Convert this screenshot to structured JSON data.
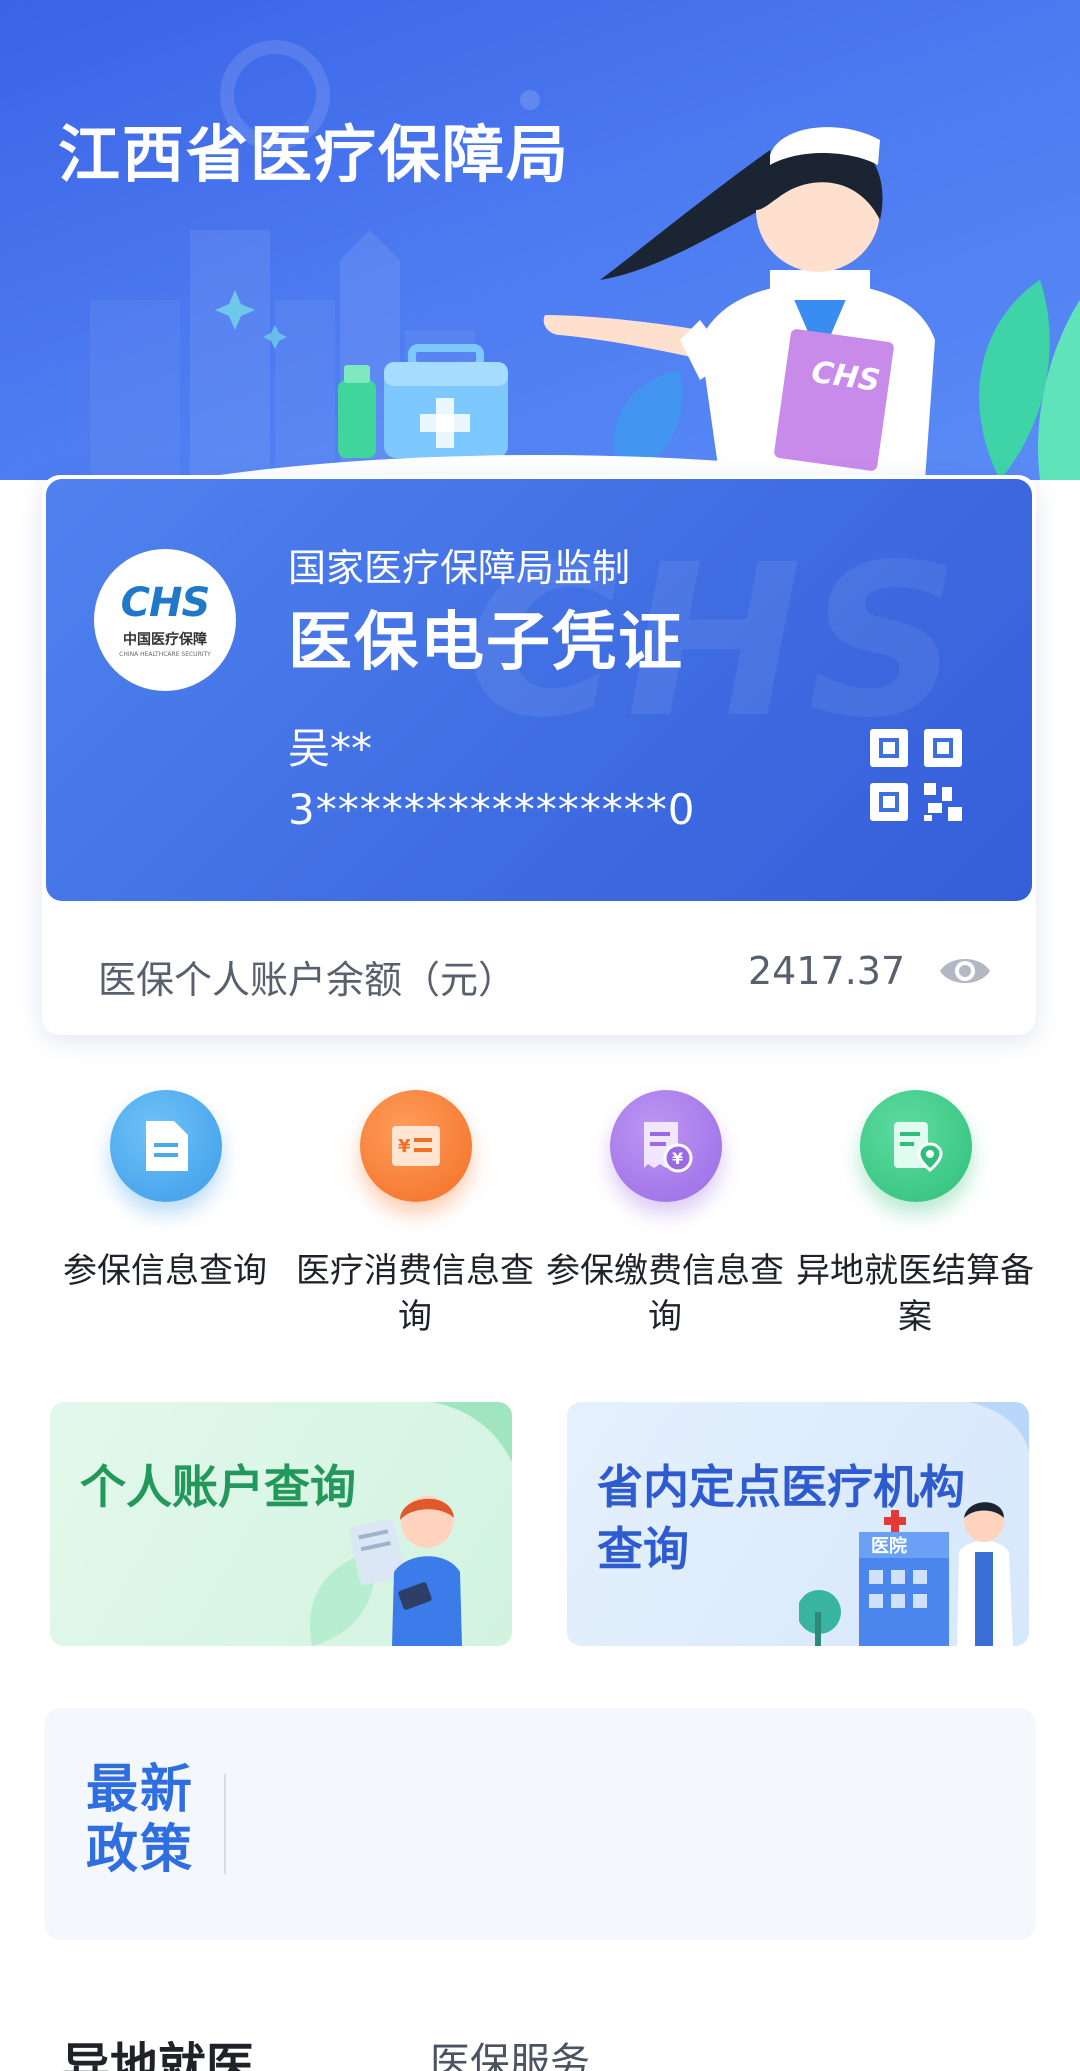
{
  "header": {
    "title": "江西省医疗保障局"
  },
  "card": {
    "logo_mark": "CHS",
    "logo_text": "中国医疗保障",
    "logo_subtext": "CHINA HEALTHCARE SECURITY",
    "supervisor": "国家医疗保障局监制",
    "title": "医保电子凭证",
    "holder_name": "吴**",
    "holder_id": "3****************0",
    "badge_text": "CHS",
    "balance_label": "医保个人账户余额（元）",
    "balance_value": "2417.37"
  },
  "services": [
    {
      "label": "参保信息查询",
      "icon": "document-icon",
      "color": "#4aa8ee"
    },
    {
      "label": "医疗消费信息查询",
      "icon": "receipt-icon",
      "color": "#f4843c"
    },
    {
      "label": "参保缴费信息查询",
      "icon": "payment-record-icon",
      "color": "#a77be9"
    },
    {
      "label": "异地就医结算备案",
      "icon": "location-doc-icon",
      "color": "#37c384"
    }
  ],
  "tiles": {
    "personal_account": "个人账户查询",
    "institution_line1": "省内定点医疗机构",
    "institution_line2": "查询",
    "hospital_sign": "医院"
  },
  "news": {
    "line1": "最新",
    "line2": "政策"
  },
  "tabs": {
    "active": "异地就医",
    "inactive": "医保服务"
  },
  "colors": {
    "hero": "#4270e8",
    "card": "#4374e6",
    "accent_green": "#22985a",
    "accent_blue": "#2e5cd0"
  }
}
